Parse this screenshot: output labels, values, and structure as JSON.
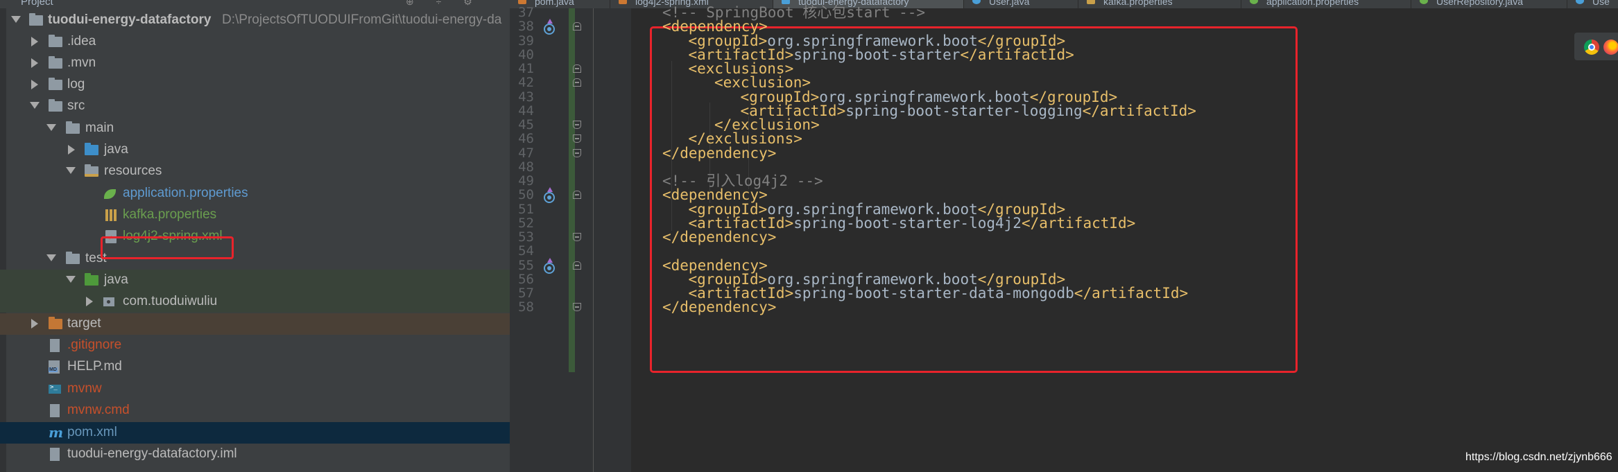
{
  "top_bar": {
    "panel_label": "Project",
    "tabs": [
      {
        "label": "pom.java",
        "active": false
      },
      {
        "label": "log4j2-spring.xml",
        "active": false
      },
      {
        "label": "tuodui-energy-datafactory",
        "active": true
      },
      {
        "label": "User.java",
        "active": false
      },
      {
        "label": "kafka.properties",
        "active": false
      },
      {
        "label": "application.properties",
        "active": false
      },
      {
        "label": "UserRepository.java",
        "active": false
      },
      {
        "label": "Use",
        "active": false
      }
    ]
  },
  "project_tree": {
    "root": {
      "name": "tuodui-energy-datafactory",
      "path": "D:\\ProjectsOfTUODUIFromGit\\tuodui-energy-da"
    },
    "items": [
      {
        "label": ".idea",
        "icon": "folder-icon"
      },
      {
        "label": ".mvn",
        "icon": "folder-icon"
      },
      {
        "label": "log",
        "icon": "folder-icon"
      },
      {
        "label": "src",
        "icon": "folder-icon"
      },
      {
        "label": "main",
        "icon": "folder-icon"
      },
      {
        "label": "java",
        "icon": "source-folder-icon"
      },
      {
        "label": "resources",
        "icon": "resources-folder-icon"
      },
      {
        "label": "application.properties",
        "icon": "spring-leaf-icon"
      },
      {
        "label": "kafka.properties",
        "icon": "properties-file-icon"
      },
      {
        "label": "log4j2-spring.xml",
        "icon": "xml-file-icon"
      },
      {
        "label": "test",
        "icon": "folder-icon"
      },
      {
        "label": "java",
        "icon": "test-folder-icon"
      },
      {
        "label": "com.tuoduiwuliu",
        "icon": "package-icon"
      },
      {
        "label": "target",
        "icon": "excluded-folder-icon"
      },
      {
        "label": ".gitignore",
        "icon": "file-icon"
      },
      {
        "label": "HELP.md",
        "icon": "markdown-file-icon"
      },
      {
        "label": "mvnw",
        "icon": "terminal-file-icon"
      },
      {
        "label": "mvnw.cmd",
        "icon": "file-icon"
      },
      {
        "label": "pom.xml",
        "icon": "maven-icon"
      },
      {
        "label": "tuodui-energy-datafactory.iml",
        "icon": "iml-file-icon"
      }
    ]
  },
  "editor": {
    "lines": [
      {
        "num": "37",
        "indent": 0,
        "type": "comment",
        "text": "<!-- SpringBoot 核心包start -->"
      },
      {
        "num": "38",
        "indent": 0,
        "type": "tag",
        "text": "<dependency>"
      },
      {
        "num": "39",
        "indent": 1,
        "type": "element",
        "open": "<groupId>",
        "value": "org.springframework.boot",
        "close": "</groupId>"
      },
      {
        "num": "40",
        "indent": 1,
        "type": "element",
        "open": "<artifactId>",
        "value": "spring-boot-starter",
        "close": "</artifactId>"
      },
      {
        "num": "41",
        "indent": 1,
        "type": "tag",
        "text": "<exclusions>"
      },
      {
        "num": "42",
        "indent": 2,
        "type": "tag",
        "text": "<exclusion>"
      },
      {
        "num": "43",
        "indent": 3,
        "type": "element",
        "open": "<groupId>",
        "value": "org.springframework.boot",
        "close": "</groupId>"
      },
      {
        "num": "44",
        "indent": 3,
        "type": "element",
        "open": "<artifactId>",
        "value": "spring-boot-starter-logging",
        "close": "</artifactId>"
      },
      {
        "num": "45",
        "indent": 2,
        "type": "tag",
        "text": "</exclusion>"
      },
      {
        "num": "46",
        "indent": 1,
        "type": "tag",
        "text": "</exclusions>"
      },
      {
        "num": "47",
        "indent": 0,
        "type": "tag",
        "text": "</dependency>"
      },
      {
        "num": "48",
        "indent": 0,
        "type": "blank",
        "text": ""
      },
      {
        "num": "49",
        "indent": 0,
        "type": "comment",
        "text": "<!-- 引入log4j2 -->"
      },
      {
        "num": "50",
        "indent": 0,
        "type": "tag",
        "text": "<dependency>"
      },
      {
        "num": "51",
        "indent": 1,
        "type": "element",
        "open": "<groupId>",
        "value": "org.springframework.boot",
        "close": "</groupId>"
      },
      {
        "num": "52",
        "indent": 1,
        "type": "element",
        "open": "<artifactId>",
        "value": "spring-boot-starter-log4j2",
        "close": "</artifactId>"
      },
      {
        "num": "53",
        "indent": 0,
        "type": "tag",
        "text": "</dependency>"
      },
      {
        "num": "54",
        "indent": 0,
        "type": "blank",
        "text": ""
      },
      {
        "num": "55",
        "indent": 0,
        "type": "tag",
        "text": "<dependency>"
      },
      {
        "num": "56",
        "indent": 1,
        "type": "element",
        "open": "<groupId>",
        "value": "org.springframework.boot",
        "close": "</groupId>"
      },
      {
        "num": "57",
        "indent": 1,
        "type": "element",
        "open": "<artifactId>",
        "value": "spring-boot-starter-data-mongodb",
        "close": "</artifactId>"
      },
      {
        "num": "58",
        "indent": 0,
        "type": "tag",
        "text": "</dependency>"
      }
    ]
  },
  "watermark": "https://blog.csdn.net/zjynb666",
  "colors": {
    "tag": "#e8bf6a",
    "text": "#a9b7c6",
    "comment": "#808080",
    "highlight_box": "#e8232b",
    "editor_bg": "#2b2b2b",
    "panel_bg": "#3c3f41"
  }
}
